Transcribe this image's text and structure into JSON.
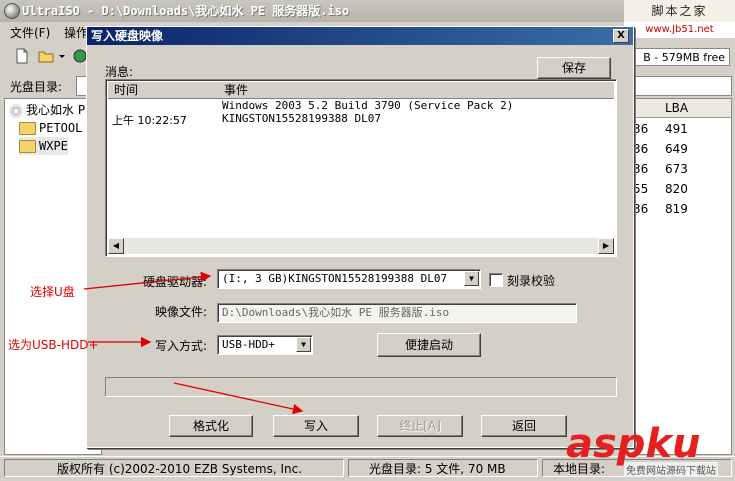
{
  "main_window": {
    "title": "UltraISO - D:\\Downloads\\我心如水 PE 服务器版.iso",
    "menu": [
      "文件(F)",
      "操作"
    ],
    "size_info": "B - 579MB free",
    "cd_dir_label": "光盘目录:",
    "tree": [
      {
        "label": "我心如水 P"
      },
      {
        "label": "PETOOL"
      },
      {
        "label": "WXPE"
      }
    ],
    "list_header": "LBA",
    "list_rows": [
      {
        "col1": "36",
        "lba": "491"
      },
      {
        "col1": "36",
        "lba": "649"
      },
      {
        "col1": "36",
        "lba": "673"
      },
      {
        "col1": "55",
        "lba": "820"
      },
      {
        "col1": "36",
        "lba": "819"
      }
    ]
  },
  "watermark": {
    "top": "脚本之家",
    "url": "www.Jb51.net",
    "aspku": "aspku",
    "aspku_sub": "免费网站源码下载站"
  },
  "dialog": {
    "title": "写入硬盘映像",
    "close": "X",
    "messages_label": "消息:",
    "save_button": "保存",
    "columns": [
      "时间",
      "事件"
    ],
    "messages": [
      {
        "time": "",
        "event": "Windows 2003 5.2 Build 3790 (Service Pack 2)"
      },
      {
        "time": "上午 10:22:57",
        "event": "KINGSTON15528199388      DL07"
      }
    ],
    "drive_label": "硬盘驱动器:",
    "drive_value": "(I:, 3 GB)KINGSTON15528199388     DL07",
    "verify_label": "刻录校验",
    "verify_checked": false,
    "image_label": "映像文件:",
    "image_value": "D:\\Downloads\\我心如水 PE 服务器版.iso",
    "write_mode_label": "写入方式:",
    "write_mode_value": "USB-HDD+",
    "boot_button": "便捷启动",
    "progress": 0,
    "buttons": {
      "format": "格式化",
      "write": "写入",
      "stop": "终止[A]",
      "back": "返回"
    }
  },
  "statusbar": {
    "copyright": "版权所有 (c)2002-2010 EZB Systems, Inc.",
    "cd_info": "光盘目录: 5 文件, 70 MB",
    "local_dir": "本地目录:"
  },
  "annotations": {
    "select_usb": "选择U盘",
    "select_hdd": "选为USB-HDD+"
  },
  "colors": {
    "annotation": "#e00000",
    "dialog_title_bg": "#0a246a"
  }
}
